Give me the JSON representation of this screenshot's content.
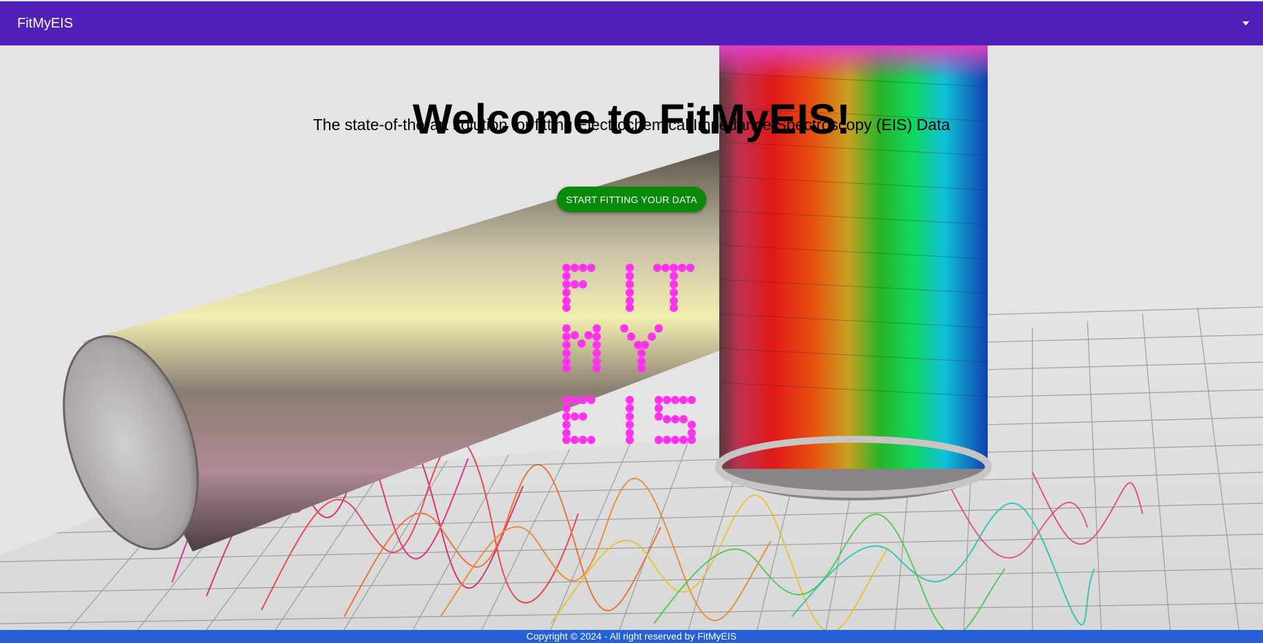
{
  "navbar": {
    "brand": "FitMyEIS",
    "toggle_icon": "caret-down-icon",
    "background": "#5020b8"
  },
  "hero": {
    "title": "Welcome to FitMyEIS!",
    "subtitle": "The state-of-the-art solution for fitting Electrochemical Impedance Spectroscopy (EIS) Data",
    "cta_label": "START FITTING YOUR DATA",
    "cta_color": "#0a8a0a",
    "logo_lines": [
      "FIT",
      "MY",
      "EIS"
    ],
    "logo_color": "#ff33ee"
  },
  "footer": {
    "text": "Copyright © 2024 - All right reserved by FitMyEIS",
    "background": "#2560d6"
  }
}
